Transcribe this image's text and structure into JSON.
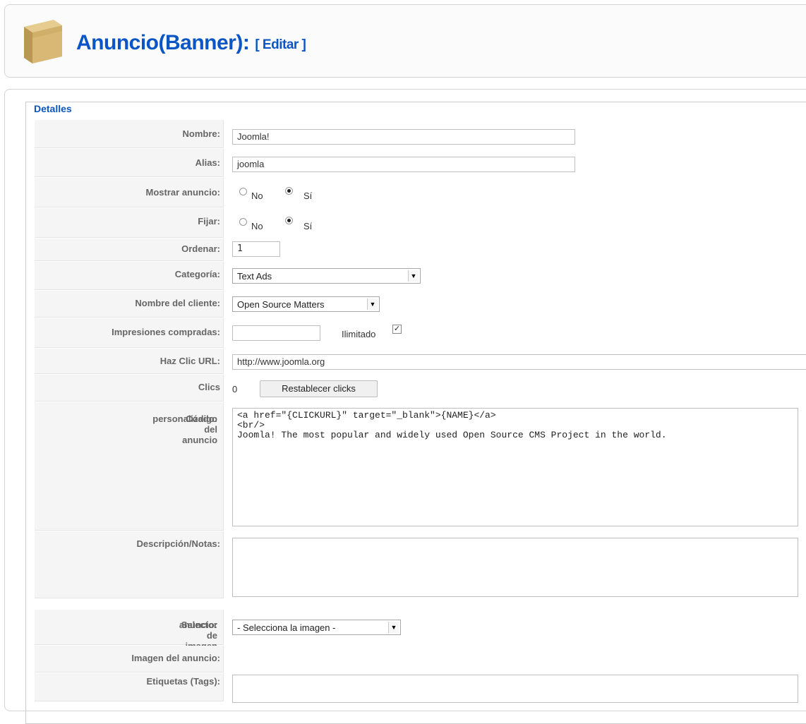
{
  "header": {
    "title": "Anuncio(Banner):",
    "subtitle": "[ Editar ]",
    "icon": "box-icon"
  },
  "fieldset": {
    "legend": "Detalles"
  },
  "fields": {
    "nombre": {
      "label": "Nombre:",
      "value": "Joomla!"
    },
    "alias": {
      "label": "Alias:",
      "value": "joomla"
    },
    "mostrar": {
      "label": "Mostrar anuncio:",
      "no": "No",
      "si": "Sí",
      "selected": "si"
    },
    "fijar": {
      "label": "Fijar:",
      "no": "No",
      "si": "Sí",
      "selected": "si"
    },
    "ordenar": {
      "label": "Ordenar:",
      "value": "1"
    },
    "categoria": {
      "label": "Categoría:",
      "value": "Text Ads"
    },
    "cliente": {
      "label": "Nombre del cliente:",
      "value": "Open Source Matters"
    },
    "impresiones": {
      "label": "Impresiones compradas:",
      "value": "",
      "ilimitado_label": "Ilimitado",
      "ilimitado_checked": true
    },
    "url": {
      "label": "Haz Clic URL:",
      "value": "http://www.joomla.org"
    },
    "clics": {
      "label": "Clics",
      "value": "0",
      "reset_label": "Restablecer clicks"
    },
    "codigo": {
      "label_line1": "Código del anuncio",
      "label_line2": "personalizado:",
      "value": "<a href=\"{CLICKURL}\" target=\"_blank\">{NAME}</a>\n<br/>\nJoomla! The most popular and widely used Open Source CMS Project in the world."
    },
    "descripcion": {
      "label": "Descripción/Notas:",
      "value": ""
    },
    "selector": {
      "label_line1": "Selector de imagen del",
      "label_line2": "anuncio:",
      "value": "- Selecciona la imagen -"
    },
    "imagen": {
      "label": "Imagen del anuncio:"
    },
    "etiquetas": {
      "label": "Etiquetas (Tags):",
      "value": ""
    }
  }
}
